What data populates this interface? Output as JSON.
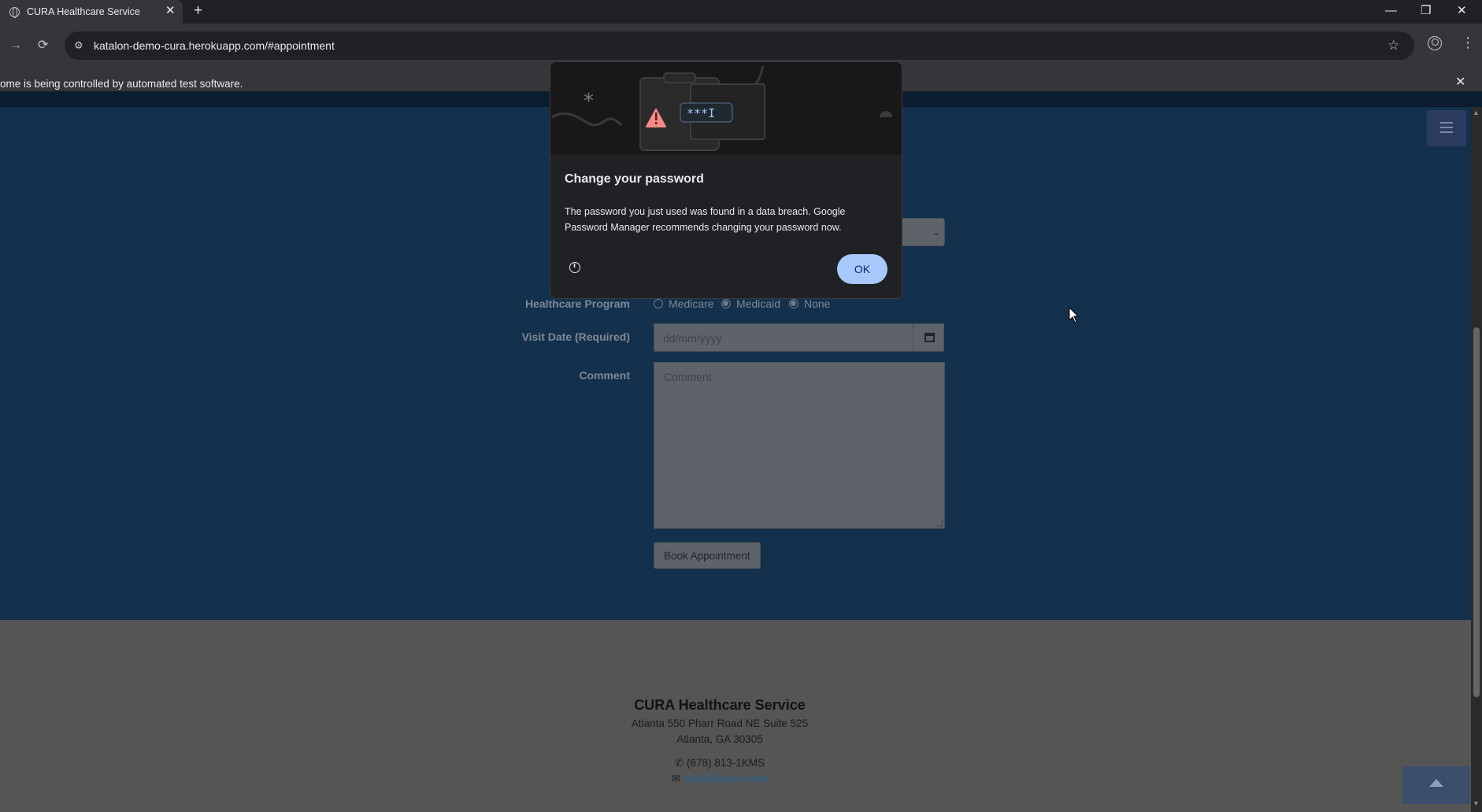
{
  "browser": {
    "tab_title": "CURA Healthcare Service",
    "tab_close": "✕",
    "new_tab": "+",
    "window": {
      "minimize": "—",
      "restore": "❐",
      "close": "✕"
    },
    "back": "←",
    "forward": "→",
    "reload": "⟳",
    "url": "katalon-demo-cura.herokuapp.com/#appointment",
    "bookmark_star": "☆",
    "menu": "⋮",
    "infobar_message": "ome is being controlled by automated test software.",
    "infobar_close": "✕"
  },
  "form": {
    "program_label": "Healthcare Program",
    "program_options": [
      "Medicare",
      "Medicaid",
      "None"
    ],
    "visit_date_label": "Visit Date (Required)",
    "visit_date_placeholder": "dd/mm/yyyy",
    "comment_label": "Comment",
    "comment_placeholder": "Comment",
    "book_button": "Book Appointment",
    "select_chevron": "⌄"
  },
  "footer": {
    "title": "CURA Healthcare Service",
    "address_line1": "Atlanta 550 Pharr Road NE Suite 525",
    "address_line2": "Atlanta, GA 30305",
    "phone": "(678) 813-1KMS",
    "email": "info@katalon.com",
    "phone_icon": "✆",
    "email_icon": "✉"
  },
  "dialog": {
    "title": "Change your password",
    "body": "The password you just used was found in a data breach. Google Password Manager recommends changing your password now.",
    "ok_label": "OK",
    "illustration_text": "***I",
    "info_glyph": "i"
  },
  "colors": {
    "dialog_bg": "#202124",
    "ok_button": "#a8c7fa",
    "warning_triangle": "#f28b82",
    "page_overlay_blue": "#13304d"
  }
}
